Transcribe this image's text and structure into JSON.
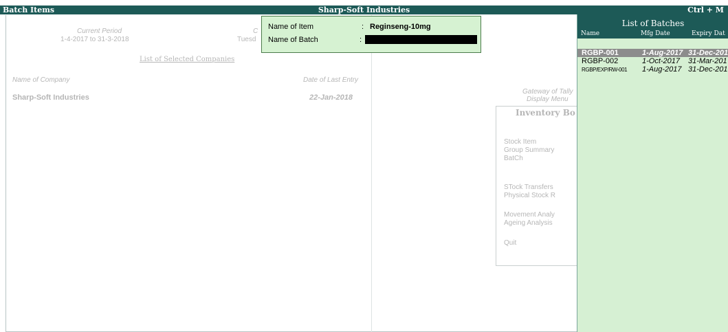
{
  "titlebar": {
    "left": "Batch Items",
    "center": "Sharp-Soft Industries",
    "right": "Ctrl + M"
  },
  "background": {
    "current_period_label": "Current Period",
    "current_period_value": "1-4-2017 to 31-3-2018",
    "current_date_fragment": "Tuesd",
    "current_date_label_fragment": "C",
    "list_selected_companies": "List of Selected Companies",
    "name_of_company_label": "Name of Company",
    "date_of_last_entry_label": "Date of Last Entry",
    "company_name": "Sharp-Soft Industries",
    "company_last_entry": "22-Jan-2018",
    "gateway_label": "Gateway of Tally",
    "display_menu_label": "Display Menu",
    "inventory_books_title": "Inventory Bo",
    "menu_items": [
      "Stock Item",
      "Group Summary",
      "BatCh",
      "STock Transfers",
      "Physical Stock R",
      "Movement Analy",
      "Ageing Analysis",
      "Quit"
    ]
  },
  "popup": {
    "name_of_item_label": "Name of Item",
    "name_of_item_value": "Reginseng-10mg",
    "name_of_batch_label": "Name of Batch",
    "colon": ":",
    "name_of_batch_value": ""
  },
  "batches_panel": {
    "title": "List of Batches",
    "columns": [
      "Name",
      "Mfg Date",
      "Expiry Dat"
    ],
    "rows": [
      {
        "name": "RGBP-001",
        "mfg": "1-Aug-2017",
        "expiry": "31-Dec-201"
      },
      {
        "name": "RGBP-002",
        "mfg": "1-Oct-2017",
        "expiry": "31-Mar-201"
      },
      {
        "name": "RGBP/EXP/RW-001",
        "mfg": "1-Aug-2017",
        "expiry": "31-Dec-201"
      }
    ]
  }
}
